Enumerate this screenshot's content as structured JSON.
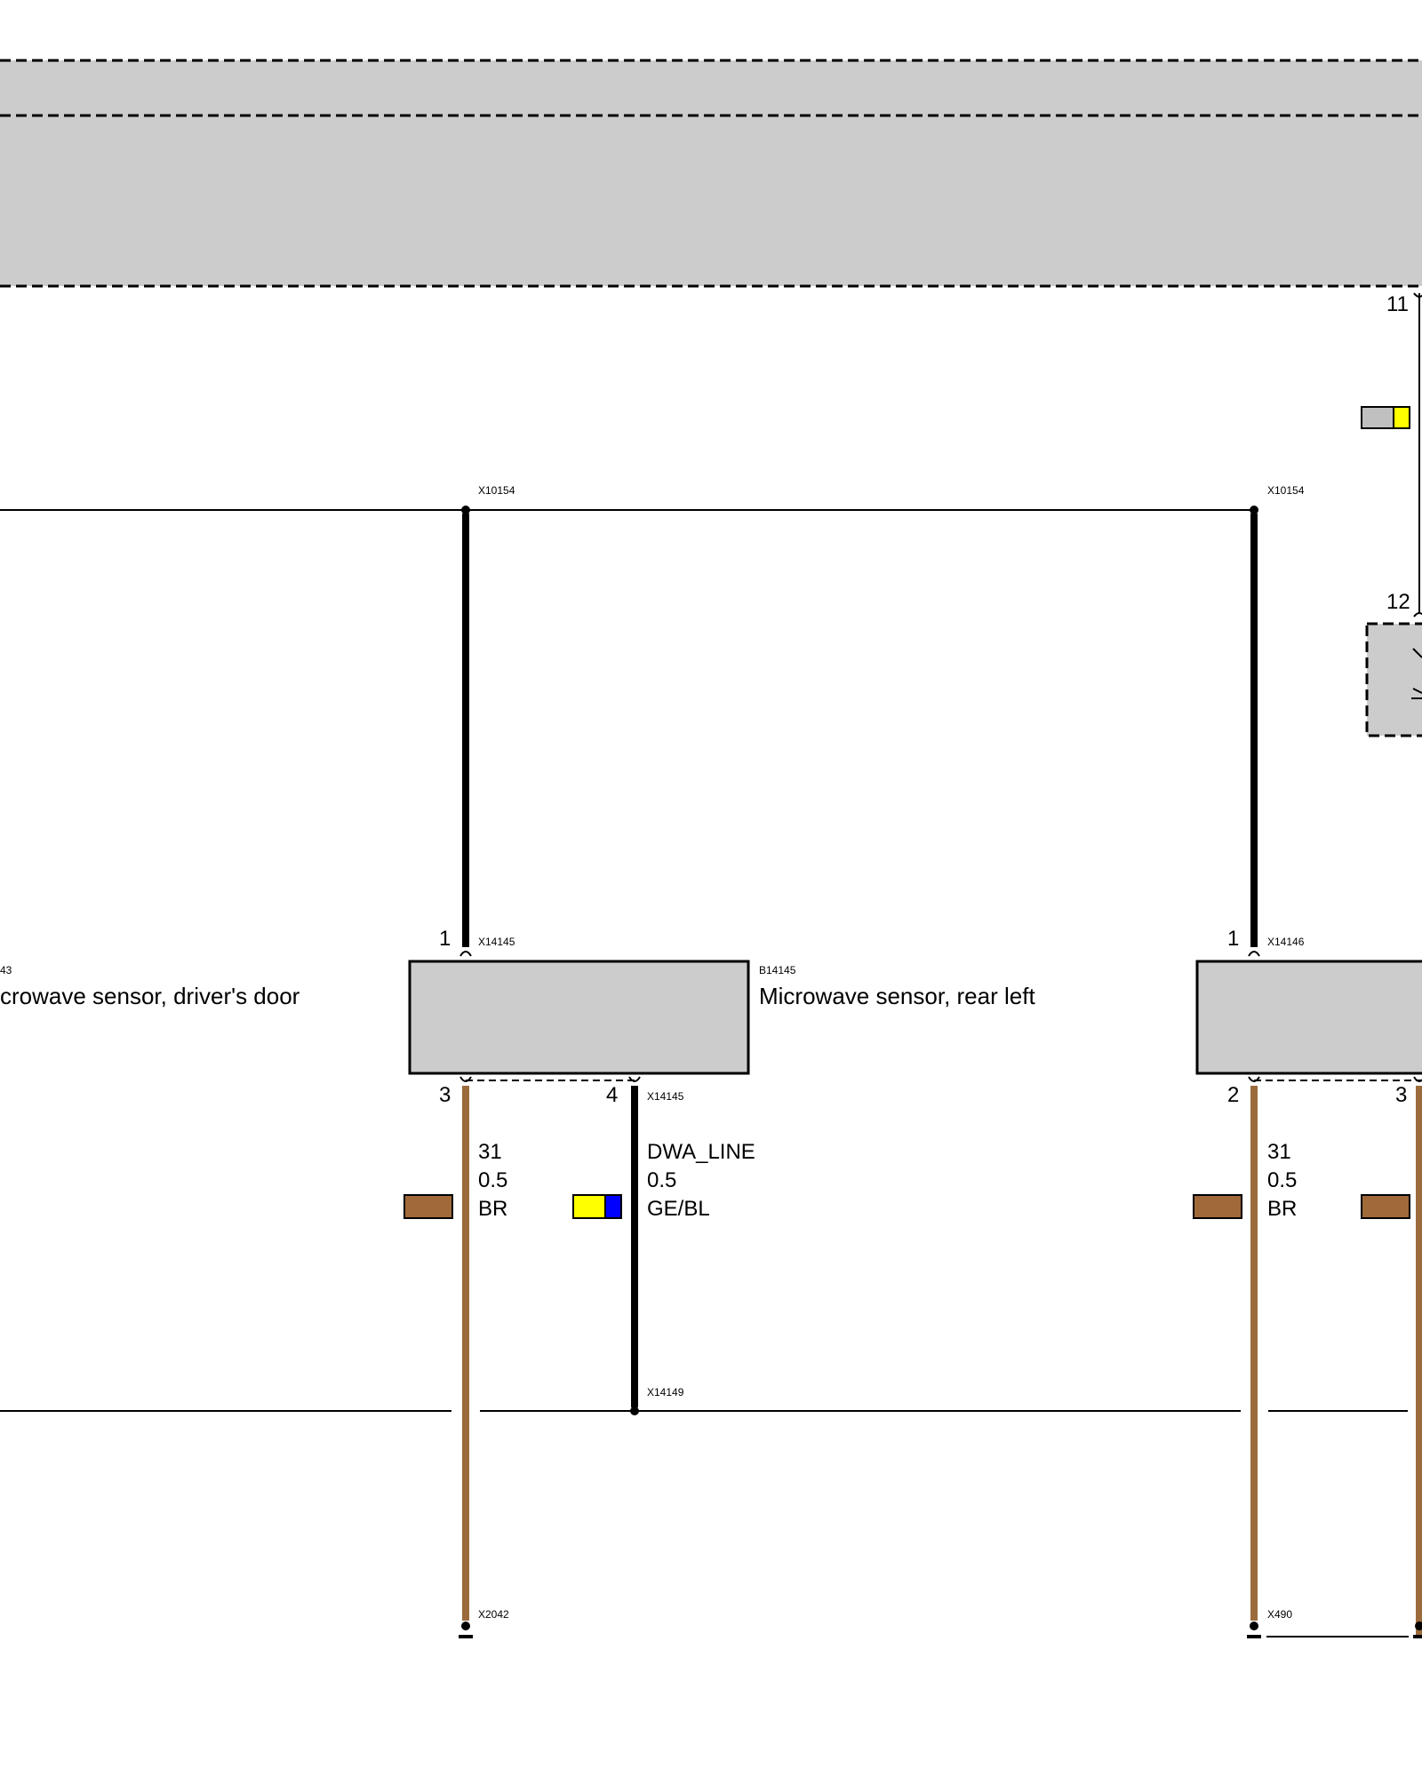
{
  "pins": {
    "top_11": "11",
    "top_12": "12",
    "s1_pin1": "1",
    "s1_pin3": "3",
    "s1_pin4": "4",
    "s2_pin1": "1",
    "s2_pin2": "2",
    "s2_pin3": "3"
  },
  "connectors": {
    "x10154_a": "X10154",
    "x10154_b": "X10154",
    "x14145_top": "X14145",
    "x14145_bottom": "X14145",
    "x14146_top": "X14146",
    "x14149": "X14149",
    "x2042": "X2042",
    "x490": "X490",
    "b14145": "B14145",
    "b_left_partial": "43"
  },
  "components": {
    "left_partial": "crowave sensor, driver's door",
    "rear_left": "Microwave sensor, rear left"
  },
  "wires": {
    "w1": {
      "signal": "31",
      "size": "0.5",
      "color_code": "BR"
    },
    "w2": {
      "signal": "DWA_LINE",
      "size": "0.5",
      "color_code": "GE/BL"
    },
    "w3": {
      "signal": "31",
      "size": "0.5",
      "color_code": "BR"
    }
  },
  "colors": {
    "brown": "#9c6b3c",
    "brown_swatch": "#a0693a",
    "yellow": "#ffff00",
    "blue": "#0000ff",
    "gray": "#c0c0c0",
    "module_fill": "#cccccc"
  }
}
